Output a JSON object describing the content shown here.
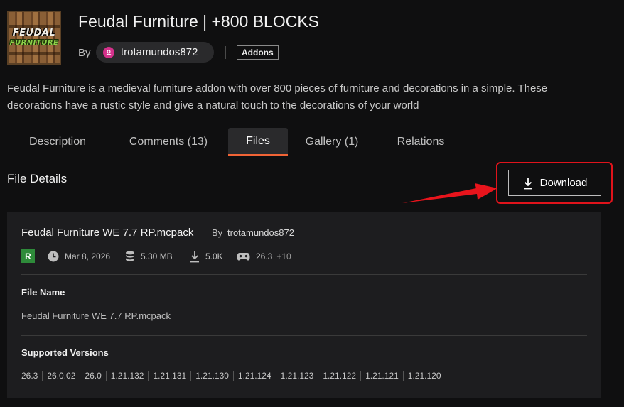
{
  "project": {
    "logo_line1": "FEUDAL",
    "logo_line2": "FURNITURE",
    "title": "Feudal Furniture | +800 BLOCKS",
    "by_label": "By",
    "author": "trotamundos872",
    "category": "Addons",
    "summary": "Feudal Furniture is a medieval furniture addon with over 800 pieces of furniture and decorations in a simple. These decorations have a rustic style and give a natural touch to the decorations of your world"
  },
  "tabs": [
    {
      "label": "Description"
    },
    {
      "label": "Comments (13)"
    },
    {
      "label": "Files",
      "active": true
    },
    {
      "label": "Gallery (1)"
    },
    {
      "label": "Relations"
    }
  ],
  "file_details": {
    "section_title": "File Details",
    "download_label": "Download",
    "file_title": "Feudal Furniture WE 7.7 RP.mcpack",
    "by_label": "By",
    "author": "trotamundos872",
    "release_type": "R",
    "date": "Mar 8, 2026",
    "size": "5.30 MB",
    "downloads": "5.0K",
    "game_version": "26.3",
    "more_versions": "+10",
    "file_name_label": "File Name",
    "file_name": "Feudal Furniture WE 7.7 RP.mcpack",
    "supported_versions_label": "Supported Versions",
    "supported_versions": [
      "26.3",
      "26.0.02",
      "26.0",
      "1.21.132",
      "1.21.131",
      "1.21.130",
      "1.21.124",
      "1.21.123",
      "1.21.122",
      "1.21.121",
      "1.21.120"
    ]
  },
  "colors": {
    "accent_tab": "#f16436",
    "highlight": "#e0131b",
    "release_badge": "#2e8b3a",
    "avatar": "#d4318b"
  },
  "icons": [
    "user-icon",
    "clock-icon",
    "database-icon",
    "download-icon",
    "gamepad-icon",
    "arrow-icon"
  ]
}
